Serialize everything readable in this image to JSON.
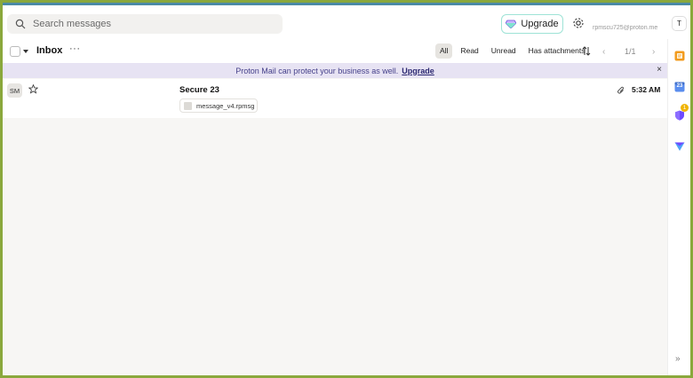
{
  "header": {
    "search_placeholder": "Search messages",
    "upgrade_label": "Upgrade",
    "user_email": "rpmscu725@proton.me",
    "user_initial": "T"
  },
  "toolbar": {
    "title": "Inbox",
    "more": "···",
    "filters": [
      "All",
      "Read",
      "Unread",
      "Has attachments"
    ],
    "active_filter": "All",
    "pager": "1/1"
  },
  "banner": {
    "text": "Proton Mail can protect your business as well.",
    "link": "Upgrade",
    "close": "×"
  },
  "messages": [
    {
      "initials": "SM",
      "subject": "Secure 23",
      "time": "5:32 AM",
      "attachment": "message_v4.rpmsg"
    }
  ],
  "rail": {
    "badge_count": "1",
    "calendar_day": "23",
    "collapse": "»"
  },
  "icons": {
    "search": "search-icon",
    "settings": "gear-icon",
    "star": "star-icon",
    "attachment": "paperclip-icon"
  },
  "colors": {
    "outer_border": "#8aa83c",
    "accent_strip": "#4a8aa6",
    "banner_bg": "#e7e3f3",
    "banner_text": "#45408a",
    "upgrade_border": "#9ee3d6"
  }
}
